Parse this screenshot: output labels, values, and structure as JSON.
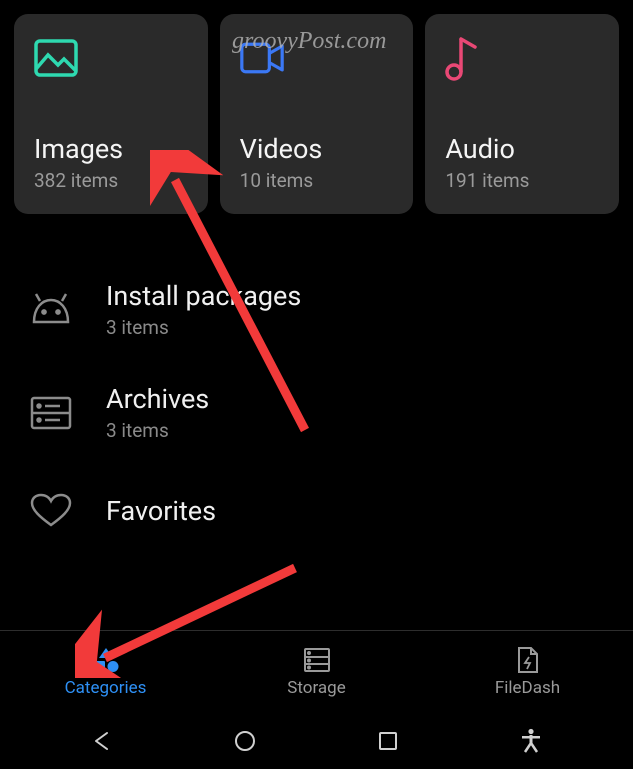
{
  "watermark": "groovyPost.com",
  "tiles": [
    {
      "title": "Images",
      "subtitle": "382 items"
    },
    {
      "title": "Videos",
      "subtitle": "10 items"
    },
    {
      "title": "Audio",
      "subtitle": "191 items"
    }
  ],
  "listItems": [
    {
      "title": "Install packages",
      "subtitle": "3 items"
    },
    {
      "title": "Archives",
      "subtitle": "3 items"
    },
    {
      "title": "Favorites",
      "subtitle": ""
    }
  ],
  "nav": {
    "categories": "Categories",
    "storage": "Storage",
    "filedash": "FileDash"
  }
}
